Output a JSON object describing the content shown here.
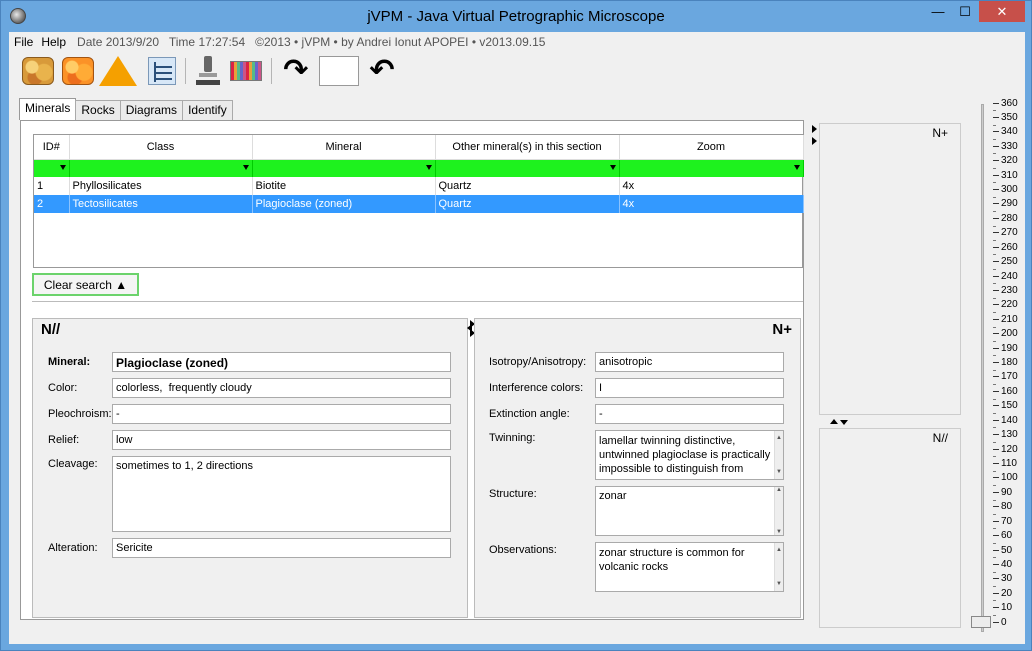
{
  "window": {
    "title": "jVPM - Java Virtual Petrographic Microscope",
    "min_glyph": "—",
    "max_glyph": "☐",
    "close_glyph": "✕"
  },
  "menu": {
    "file": "File",
    "help": "Help",
    "info": "Date 2013/9/20   Time 17:27:54   ©2013 • jVPM • by Andrei Ionut APOPEI • v2013.09.15"
  },
  "toolbar": {
    "icons": [
      "minerals-icon",
      "rocks-icon",
      "diagram-triangle-icon",
      "tree-view-icon",
      "microscope-icon",
      "spectrum-icon",
      "rotate-down-icon",
      "blank-field",
      "rotate-up-icon"
    ],
    "rotate_down_glyph": "↷",
    "rotate_up_glyph": "↶"
  },
  "tabs": [
    {
      "label": "Minerals",
      "active": true
    },
    {
      "label": "Rocks",
      "active": false
    },
    {
      "label": "Diagrams",
      "active": false
    },
    {
      "label": "Identify",
      "active": false
    }
  ],
  "grid": {
    "columns": [
      "ID#",
      "Class",
      "Mineral",
      "Other mineral(s) in this section",
      "Zoom"
    ],
    "rows": [
      {
        "id": "1",
        "class": "Phyllosilicates",
        "mineral": "Biotite",
        "other": "Quartz",
        "zoom": "4x",
        "selected": false
      },
      {
        "id": "2",
        "class": "Tectosilicates",
        "mineral": "Plagioclase (zoned)",
        "other": "Quartz",
        "zoom": "4x",
        "selected": true
      }
    ],
    "filter_color": "#1ef21e",
    "selection_color": "#3399ff"
  },
  "clear_search": "Clear search ▲",
  "n_parallel": {
    "heading": "N//",
    "mineral_label": "Mineral:",
    "mineral_value": "Plagioclase (zoned)",
    "color_label": "Color:",
    "color_value": "colorless,  frequently cloudy",
    "pleochroism_label": "Pleochroism:",
    "pleochroism_value": "-",
    "relief_label": "Relief:",
    "relief_value": "low",
    "cleavage_label": "Cleavage:",
    "cleavage_value": "sometimes to 1, 2 directions",
    "alteration_label": "Alteration:",
    "alteration_value": "Sericite"
  },
  "n_crossed": {
    "heading": "N+",
    "isotropy_label": "Isotropy/Anisotropy:",
    "isotropy_value": "anisotropic",
    "interference_label": "Interference colors:",
    "interference_value": "I",
    "extinction_label": "Extinction angle:",
    "extinction_value": "-",
    "twinning_label": "Twinning:",
    "twinning_value": "lamellar twinning distinctive, untwinned plagioclase is practically impossible to distinguish from",
    "structure_label": "Structure:",
    "structure_value": "zonar",
    "observations_label": "Observations:",
    "observations_value": "zonar structure is common for volcanic rocks"
  },
  "side": {
    "top_label": "N+",
    "bottom_label": "N//"
  },
  "scale": {
    "labels": [
      "360",
      "350",
      "340",
      "330",
      "320",
      "310",
      "300",
      "290",
      "280",
      "270",
      "260",
      "250",
      "240",
      "230",
      "220",
      "210",
      "200",
      "190",
      "180",
      "170",
      "160",
      "150",
      "140",
      "130",
      "120",
      "110",
      "100",
      "90",
      "80",
      "70",
      "60",
      "50",
      "40",
      "30",
      "20",
      "10",
      "0"
    ],
    "value": 0
  }
}
